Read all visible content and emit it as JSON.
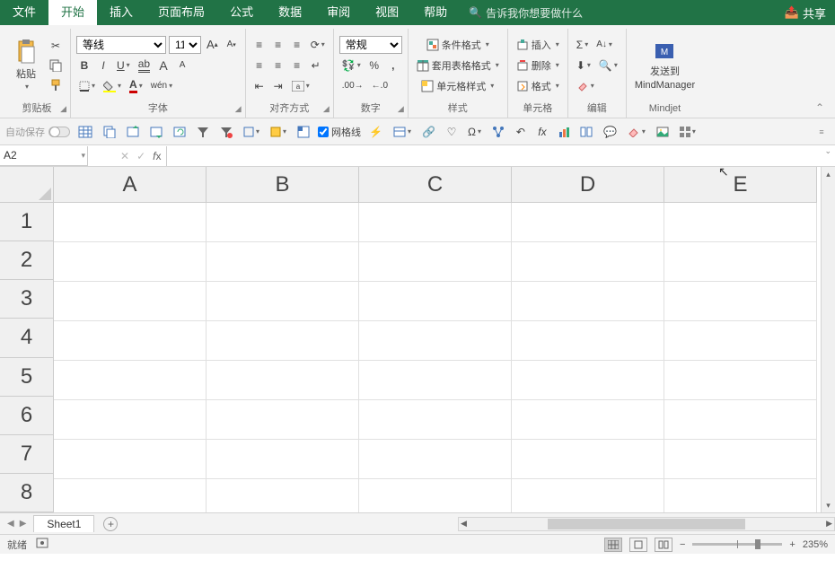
{
  "tabs": {
    "file": "文件",
    "home": "开始",
    "insert": "插入",
    "layout": "页面布局",
    "formula": "公式",
    "data": "数据",
    "review": "审阅",
    "view": "视图",
    "help": "帮助"
  },
  "search_placeholder": "告诉我你想要做什么",
  "share": "共享",
  "ribbon": {
    "clipboard": {
      "paste": "粘贴",
      "label": "剪贴板"
    },
    "font": {
      "name": "等线",
      "size": "11",
      "label": "字体",
      "phonetic": "wén"
    },
    "align": {
      "label": "对齐方式"
    },
    "number": {
      "format": "常规",
      "label": "数字"
    },
    "styles": {
      "cond": "条件格式",
      "table": "套用表格格式",
      "cell": "单元格样式",
      "label": "样式"
    },
    "cells": {
      "insert": "插入",
      "delete": "删除",
      "format": "格式",
      "label": "单元格"
    },
    "editing": {
      "label": "编辑"
    },
    "mindjet": {
      "send": "发送到",
      "mm": "MindManager",
      "label": "Mindjet"
    }
  },
  "qat": {
    "autosave": "自动保存",
    "gridlines": "网格线"
  },
  "namebox": "A2",
  "columns": [
    "A",
    "B",
    "C",
    "D",
    "E"
  ],
  "rows": [
    "1",
    "2",
    "3",
    "4",
    "5",
    "6",
    "7",
    "8"
  ],
  "sheet": "Sheet1",
  "status": {
    "ready": "就绪",
    "zoom": "235%"
  }
}
